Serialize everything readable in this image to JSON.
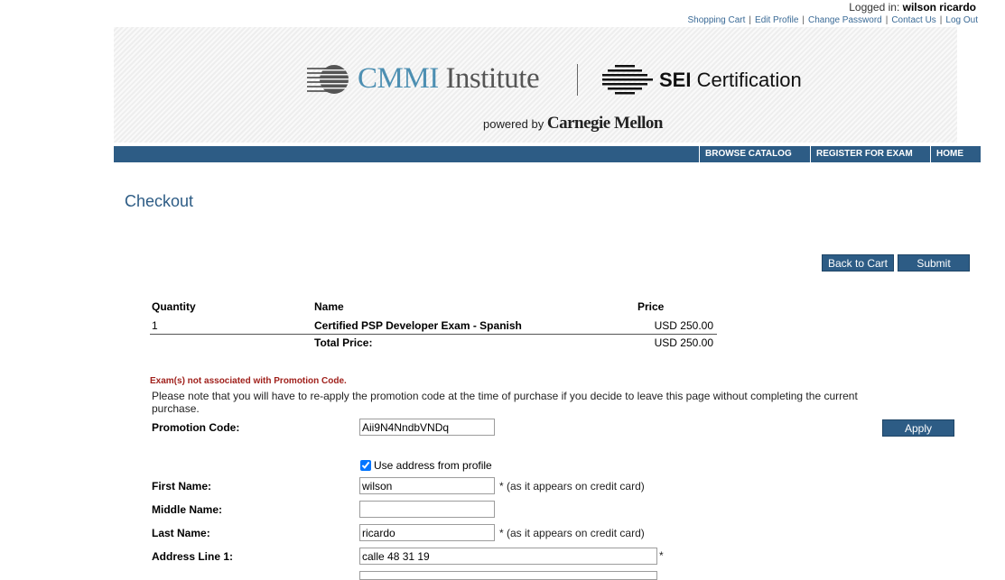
{
  "account": {
    "logged_in_prefix": "Logged in:",
    "user_name": "wilson ricardo",
    "links": [
      "Shopping Cart",
      "Edit Profile",
      "Change Password",
      "Contact Us",
      "Log Out"
    ],
    "link_separator": "|"
  },
  "banner": {
    "cmmi_brand": "CMMI",
    "cmmi_institute": "Institute",
    "sei_bold": "SEI",
    "sei_rest": "Certification",
    "powered_by": "powered by",
    "carnegie_mellon": "Carnegie Mellon"
  },
  "nav": {
    "items": [
      "BROWSE CATALOG",
      "REGISTER FOR EXAM",
      "HOME"
    ]
  },
  "page": {
    "title": "Checkout"
  },
  "actions": {
    "back_to_cart": "Back to Cart",
    "submit": "Submit",
    "apply": "Apply"
  },
  "cart": {
    "headers": {
      "quantity": "Quantity",
      "name": "Name",
      "price": "Price"
    },
    "rows": [
      {
        "quantity": "1",
        "name": "Certified PSP Developer Exam - Spanish",
        "price": "USD 250.00"
      }
    ],
    "total_label": "Total Price:",
    "total_value": "USD 250.00"
  },
  "promotion": {
    "error": "Exam(s) not associated with Promotion Code.",
    "note": "Please note that you will have to re-apply the promotion code at the time of purchase if you decide to leave this page without completing the current purchase.",
    "label": "Promotion Code:",
    "value": "Aii9N4NndbVNDq"
  },
  "billing": {
    "use_address_label": "Use address from profile",
    "use_address_checked": true,
    "first_name_label": "First Name:",
    "first_name_value": "wilson",
    "middle_name_label": "Middle Name:",
    "middle_name_value": "",
    "last_name_label": "Last Name:",
    "last_name_value": "ricardo",
    "address1_label": "Address Line 1:",
    "address1_value": "calle 48 31 19",
    "card_hint": "* (as it appears on credit card)",
    "required_mark": "*"
  },
  "colors": {
    "primary": "#2d5c85",
    "link": "#3a6a96",
    "error": "#a0211c",
    "cmmi_blue": "#4d8fb2"
  }
}
